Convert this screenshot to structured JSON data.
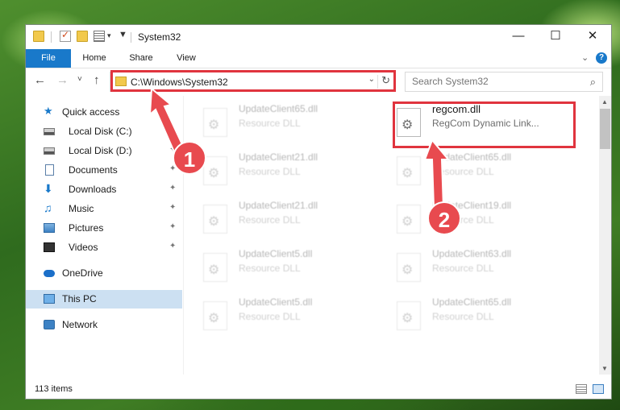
{
  "window": {
    "title": "System32",
    "controls": {
      "minimize": "—",
      "maximize": "☐",
      "close": "✕"
    }
  },
  "ribbon": {
    "tabs": [
      "File",
      "Home",
      "Share",
      "View"
    ],
    "expand_icon": "chevron-down",
    "help": "?"
  },
  "nav": {
    "back": "←",
    "forward": "→",
    "recent": "˅",
    "up": "↑",
    "address": "C:\\Windows\\System32",
    "refresh": "↻",
    "search_placeholder": "Search System32",
    "search_icon": "⌕"
  },
  "sidebar": {
    "items": [
      {
        "label": "Quick access",
        "icon": "star-icon",
        "pinned": false
      },
      {
        "label": "Local Disk (C:)",
        "icon": "disk-icon",
        "pinned": false
      },
      {
        "label": "Local Disk (D:)",
        "icon": "disk-icon",
        "pinned": true
      },
      {
        "label": "Documents",
        "icon": "documents-icon",
        "pinned": true
      },
      {
        "label": "Downloads",
        "icon": "downloads-icon",
        "pinned": true
      },
      {
        "label": "Music",
        "icon": "music-icon",
        "pinned": true
      },
      {
        "label": "Pictures",
        "icon": "pictures-icon",
        "pinned": true
      },
      {
        "label": "Videos",
        "icon": "videos-icon",
        "pinned": true
      },
      {
        "label": "OneDrive",
        "icon": "onedrive-icon",
        "pinned": false
      },
      {
        "label": "This PC",
        "icon": "this-pc-icon",
        "pinned": false,
        "selected": true
      },
      {
        "label": "Network",
        "icon": "network-icon",
        "pinned": false
      }
    ],
    "pin_glyph": "📌"
  },
  "files": {
    "left": [
      {
        "name": "UpdateClient65.dll",
        "type": "Resource DLL"
      },
      {
        "name": "UpdateClient21.dll",
        "type": "Resource DLL"
      },
      {
        "name": "UpdateClient21.dll",
        "type": "Resource DLL"
      },
      {
        "name": "UpdateClient5.dll",
        "type": "Resource DLL"
      },
      {
        "name": "UpdateClient5.dll",
        "type": "Resource DLL"
      }
    ],
    "right": [
      {
        "name": "regcom.dll",
        "type": "RegCom Dynamic Link...",
        "highlighted": true
      },
      {
        "name": "UpdateClient65.dll",
        "type": "Resource DLL"
      },
      {
        "name": "UpdateClient19.dll",
        "type": "Resource DLL"
      },
      {
        "name": "UpdateClient63.dll",
        "type": "Resource DLL"
      },
      {
        "name": "UpdateClient65.dll",
        "type": "Resource DLL"
      }
    ]
  },
  "status": {
    "item_count": "113 items"
  },
  "annotations": {
    "step1": "1",
    "step2": "2",
    "color": "#e0343e"
  },
  "colors": {
    "accent": "#1979ca",
    "selection": "#cce0f2"
  }
}
